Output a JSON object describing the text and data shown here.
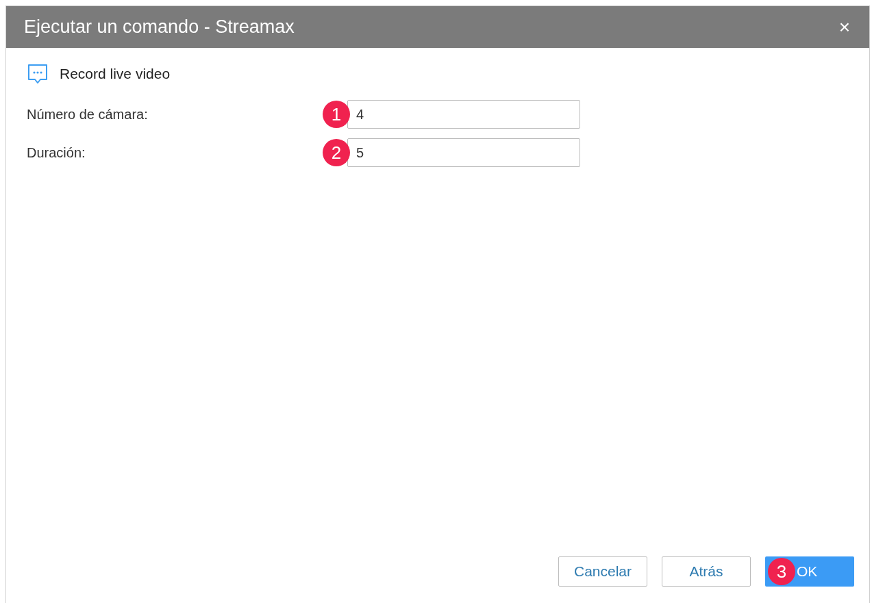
{
  "window": {
    "title": "Ejecutar un comando - Streamax",
    "close": "×"
  },
  "command": {
    "label": "Record live video"
  },
  "fields": [
    {
      "label": "Número de cámara:",
      "value": "4",
      "badge": "1"
    },
    {
      "label": "Duración:",
      "value": "5",
      "badge": "2"
    }
  ],
  "buttons": [
    {
      "label": "Cancelar",
      "kind": "secondary"
    },
    {
      "label": "Atrás",
      "kind": "secondary"
    },
    {
      "label": "OK",
      "kind": "primary",
      "badge": "3"
    }
  ]
}
